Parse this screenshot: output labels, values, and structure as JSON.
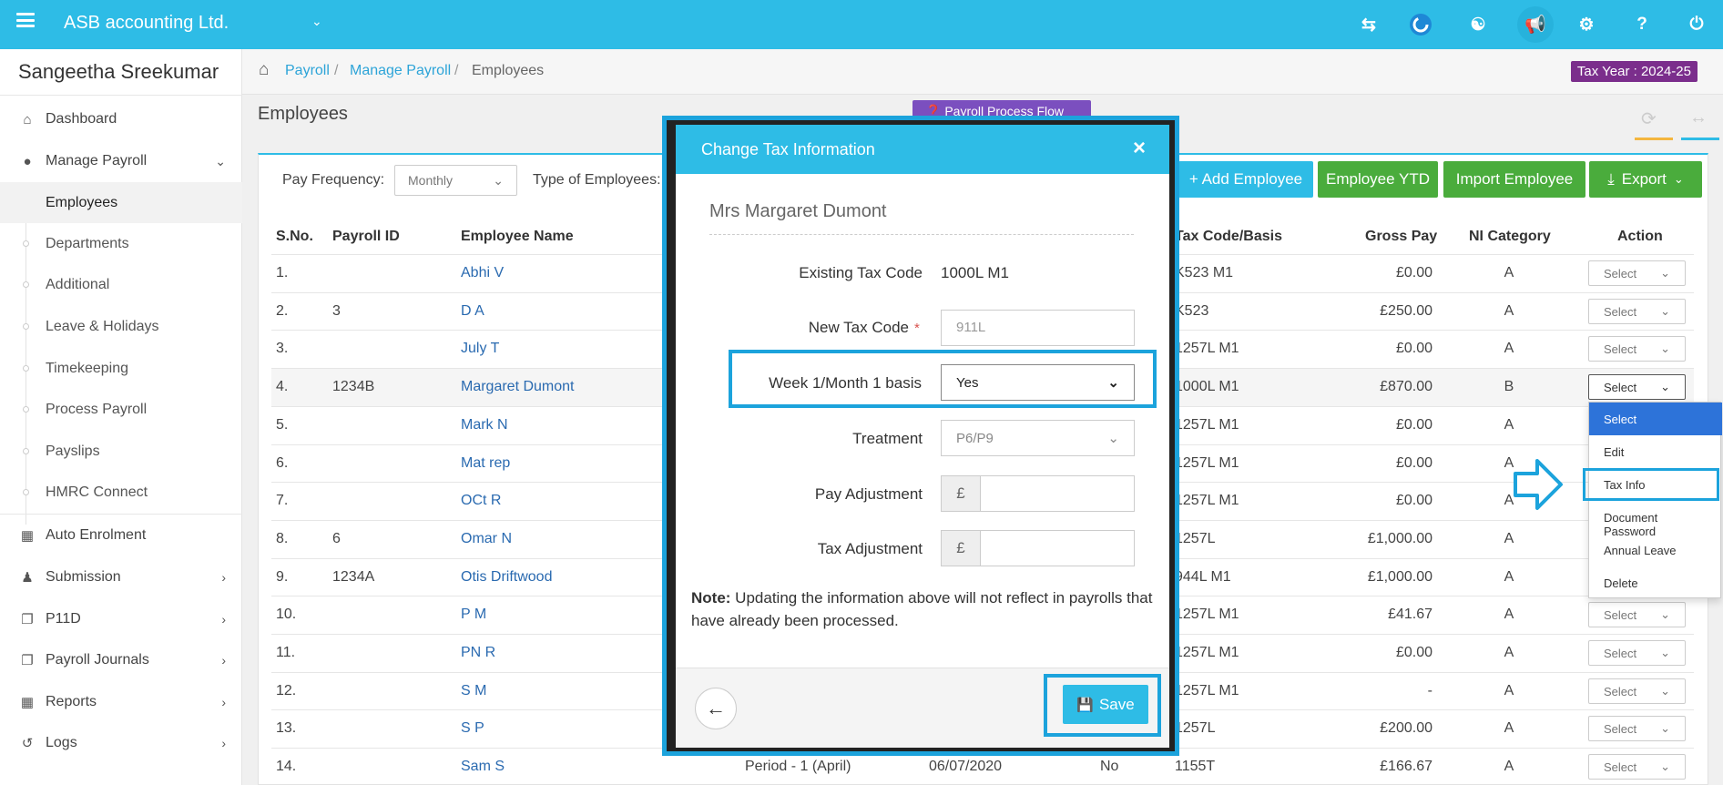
{
  "topbar": {
    "company": "ASB accounting Ltd.",
    "icons": [
      "menu-icon",
      "switch-icon",
      "c-logo-icon",
      "users-icon",
      "megaphone-icon",
      "ticket-icon",
      "help-icon",
      "power-icon"
    ]
  },
  "sidebar": {
    "user": "Sangeetha Sreekumar",
    "items": [
      {
        "label": "Dashboard",
        "icon": "home-icon"
      },
      {
        "label": "Manage Payroll",
        "icon": "user-icon"
      },
      {
        "label": "Auto Enrolment",
        "icon": "grid-icon"
      },
      {
        "label": "Submission",
        "icon": "group-icon"
      },
      {
        "label": "P11D",
        "icon": "copy-icon"
      },
      {
        "label": "Payroll Journals",
        "icon": "copy-icon"
      },
      {
        "label": "Reports",
        "icon": "building-icon"
      },
      {
        "label": "Logs",
        "icon": "history-icon"
      }
    ],
    "sub_items": [
      "Employees",
      "Departments",
      "Additional",
      "Leave & Holidays",
      "Timekeeping",
      "Process Payroll",
      "Payslips",
      "HMRC Connect"
    ]
  },
  "breadcrumb": {
    "items": [
      "Payroll",
      "Manage Payroll",
      "Employees"
    ],
    "tax_year": "Tax Year : 2024-25"
  },
  "page": {
    "title": "Employees",
    "process_flow_label": "❓ Payroll Process Flow"
  },
  "filters": {
    "pay_frequency_label": "Pay Frequency:",
    "pay_frequency_value": "Monthly",
    "type_label": "Type of Employees:"
  },
  "buttons": {
    "add_employee": "+ Add Employee",
    "employee_ytd": "Employee YTD",
    "import_employee": "Import Employee",
    "export": "Export"
  },
  "table": {
    "headers": {
      "sno": "S.No.",
      "payroll_id": "Payroll ID",
      "name": "Employee Name",
      "tax_code": "Tax Code/Basis",
      "gross": "Gross Pay",
      "ni": "NI Category",
      "action": "Action"
    },
    "rows": [
      {
        "sno": "1.",
        "pid": "",
        "name": "Abhi V",
        "tax": "K523 M1",
        "gross": "£0.00",
        "ni": "A"
      },
      {
        "sno": "2.",
        "pid": "3",
        "name": "D A",
        "tax": "K523",
        "gross": "£250.00",
        "ni": "A"
      },
      {
        "sno": "3.",
        "pid": "",
        "name": "July T",
        "tax": "1257L M1",
        "gross": "£0.00",
        "ni": "A"
      },
      {
        "sno": "4.",
        "pid": "1234B",
        "name": "Margaret Dumont",
        "tax": "1000L M1",
        "gross": "£870.00",
        "ni": "B"
      },
      {
        "sno": "5.",
        "pid": "",
        "name": "Mark N",
        "tax": "1257L M1",
        "gross": "£0.00",
        "ni": "A"
      },
      {
        "sno": "6.",
        "pid": "",
        "name": "Mat rep",
        "tax": "1257L M1",
        "gross": "£0.00",
        "ni": "A"
      },
      {
        "sno": "7.",
        "pid": "",
        "name": "OCt R",
        "tax": "1257L M1",
        "gross": "£0.00",
        "ni": "A"
      },
      {
        "sno": "8.",
        "pid": "6",
        "name": "Omar N",
        "tax": "1257L",
        "gross": "£1,000.00",
        "ni": "A"
      },
      {
        "sno": "9.",
        "pid": "1234A",
        "name": "Otis Driftwood",
        "tax": "944L M1",
        "gross": "£1,000.00",
        "ni": "A"
      },
      {
        "sno": "10.",
        "pid": "",
        "name": "P M",
        "tax": "1257L M1",
        "gross": "£41.67",
        "ni": "A"
      },
      {
        "sno": "11.",
        "pid": "",
        "name": "PN R",
        "tax": "1257L M1",
        "gross": "£0.00",
        "ni": "A"
      },
      {
        "sno": "12.",
        "pid": "",
        "name": "S M",
        "tax": "1257L M1",
        "gross": "-",
        "ni": "A"
      },
      {
        "sno": "13.",
        "pid": "",
        "name": "S P",
        "tax": "1257L",
        "gross": "£200.00",
        "ni": "A"
      },
      {
        "sno": "14.",
        "pid": "",
        "name": "Sam S",
        "tax": "1155T",
        "gross": "£166.67",
        "ni": "A",
        "period": "Period - 1 (April)",
        "date": "06/07/2020",
        "flag": "No"
      }
    ],
    "action_placeholder": "Select"
  },
  "action_menu": [
    "Select",
    "Edit",
    "Tax Info",
    "Document Password",
    "Annual Leave",
    "Delete"
  ],
  "modal": {
    "title": "Change Tax Information",
    "close": "×",
    "employee": "Mrs Margaret Dumont",
    "existing_label": "Existing Tax Code",
    "existing_value": "1000L M1",
    "new_label": "New Tax Code",
    "required_mark": "*",
    "new_placeholder": "911L",
    "week_label": "Week 1/Month 1 basis",
    "week_value": "Yes",
    "treatment_label": "Treatment",
    "treatment_value": "P6/P9",
    "pay_adj_label": "Pay Adjustment",
    "tax_adj_label": "Tax Adjustment",
    "currency": "£",
    "note_bold": "Note:",
    "note_text": " Updating the information above will not reflect in payrolls that have already been processed.",
    "save": "Save"
  }
}
